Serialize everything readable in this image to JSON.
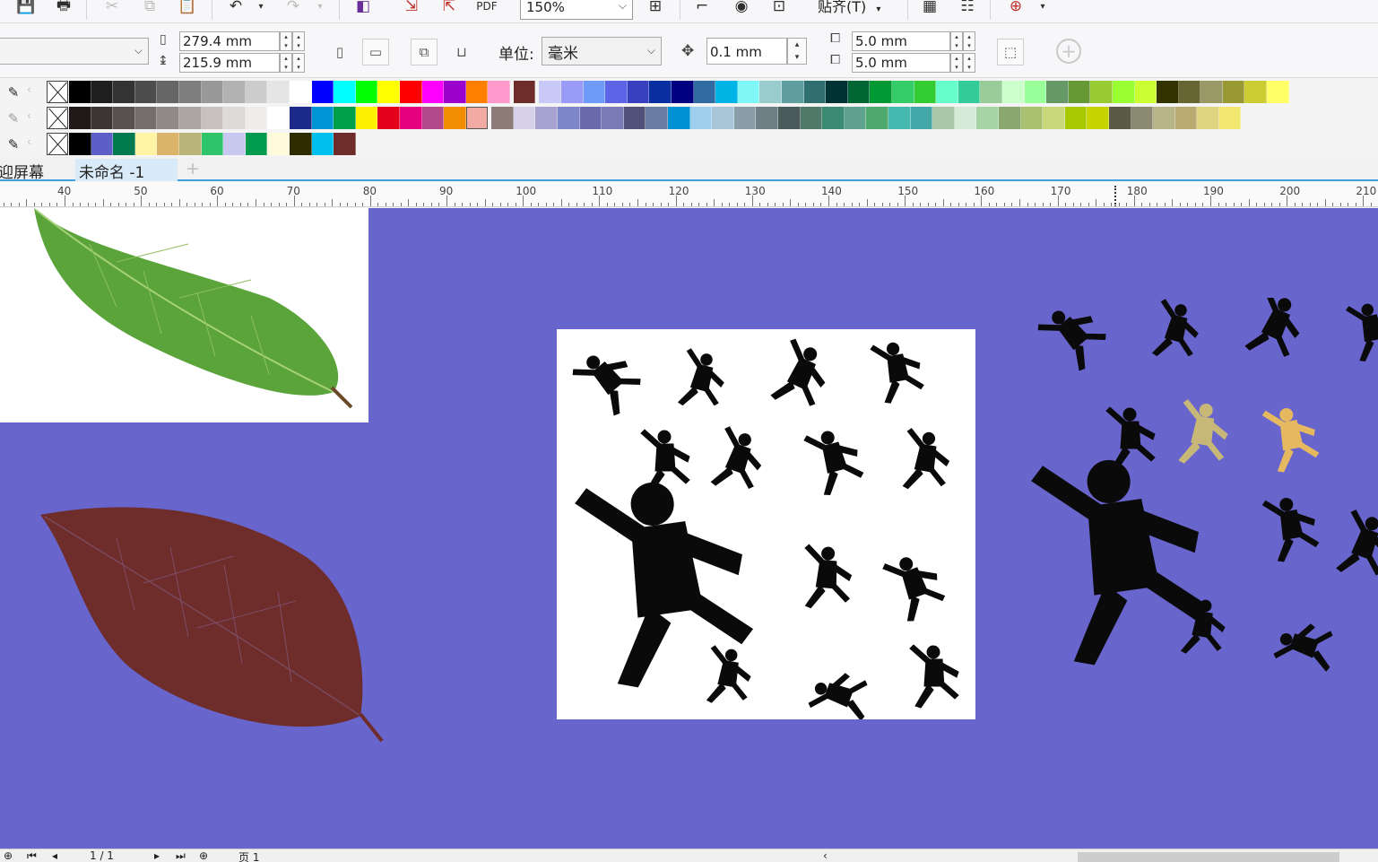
{
  "toolbar": {
    "zoom_value": "150%",
    "snap_label": "贴齐(T)",
    "icons": [
      "save-icon",
      "print-icon",
      "cut-icon",
      "copy-icon",
      "paste-icon",
      "undo-icon",
      "redo-icon",
      "import-icon",
      "export-icon",
      "publish-pdf-icon",
      "zoom-full-icon",
      "rulers-icon",
      "view-icon",
      "guides-icon",
      "options-icon",
      "launch-icon"
    ]
  },
  "property_bar": {
    "page_width": "279.4 mm",
    "page_height": "215.9 mm",
    "unit_label": "单位:",
    "unit_value": "毫米",
    "nudge_value": "0.1 mm",
    "dup_x": "5.0 mm",
    "dup_y": "5.0 mm"
  },
  "palettes": {
    "row1": [
      "#000000",
      "#1e1e1e",
      "#333333",
      "#4c4c4c",
      "#666666",
      "#7f7f7f",
      "#999999",
      "#b2b2b2",
      "#cccccc",
      "#e5e5e5",
      "#ffffff",
      "#0000ff",
      "#00ffff",
      "#00ff00",
      "#ffff00",
      "#ff0000",
      "#ff00ff",
      "#9c00cc",
      "#ff7f00",
      "#ff99cc",
      "gap",
      "#6e2c2a",
      "gap",
      "#c9c9f7",
      "#9a9af7",
      "#6f9af7",
      "#5e64e6",
      "#3940c0",
      "#0a2fa0",
      "#000080",
      "#2f6aa0",
      "#00b4e6",
      "#7ff7f7",
      "#99cccc",
      "#5f9f9f",
      "#2f6f6f",
      "#003333",
      "#006633",
      "#009933",
      "#33cc66",
      "#33cc33",
      "#66ffcc",
      "#33cc99",
      "#99cc99",
      "#ccffcc",
      "#99ff99",
      "#669966",
      "#669933",
      "#99cc33",
      "#99ff33",
      "#ccff33",
      "#333300",
      "#666633",
      "#999966",
      "#999933",
      "#cccc33",
      "#ffff66"
    ],
    "row2": [
      "#1f1a17",
      "#3b3633",
      "#57524f",
      "#736e6b",
      "#8f8a87",
      "#aba6a3",
      "#c7c2bf",
      "#dedad7",
      "#f0ecea",
      "#ffffff",
      "#1c2a8a",
      "#0096d6",
      "#00a04a",
      "#fff200",
      "#e2001a",
      "#e6007e",
      "#b2478a",
      "#f28c00",
      "#f2aaa4",
      "gap",
      "#8c7b76",
      "#d6d0e8",
      "#a7a2d0",
      "#7d86c9",
      "#6a6bae",
      "#7a7ab6",
      "#50507a",
      "#6b7ca3",
      "#0091d2",
      "#9ed0ee",
      "#a9c6d8",
      "#8a9ea7",
      "#6e8086",
      "#4b5a5a",
      "#4f7a6a",
      "#3d8a72",
      "#5fa28d",
      "#4fa86e",
      "#45b8b0",
      "#45a8a8",
      "#a9c7a6",
      "#d6e8d6",
      "#a7d4a7",
      "#8aa870",
      "#a8c070",
      "#c8d87a",
      "#a8c800",
      "#c8d400",
      "#5a5a46",
      "#8a8a70",
      "#b8b48a",
      "#b8aa70",
      "#e0d480",
      "#f2e870"
    ],
    "row3": [
      "#000000",
      "#5e5ec9",
      "#007a4e",
      "#fff4a3",
      "#d9b46a",
      "#b8b47a",
      "#2ec46a",
      "#c8c8f0",
      "#009b4e",
      "#fffadc",
      "#2e2c00",
      "#00c0ef",
      "#6e2c2a"
    ]
  },
  "tabs": {
    "welcome": "迎屏幕",
    "document": "未命名 -1"
  },
  "ruler": {
    "labels": [
      "40",
      "50",
      "60",
      "70",
      "80",
      "90",
      "100",
      "110",
      "120",
      "130",
      "140",
      "150",
      "160",
      "170",
      "180",
      "190",
      "200",
      "210"
    ]
  },
  "status": {
    "page_count": "1 / 1",
    "page_tab": "页 1"
  },
  "canvas": {
    "background": "#6865cc",
    "leaf_green": "#5aa43a",
    "leaf_brown": "#6e2c2a",
    "silhouette": "#0a0a0a",
    "silhouette_tan1": "#c8b878",
    "silhouette_tan2": "#e6b860"
  }
}
